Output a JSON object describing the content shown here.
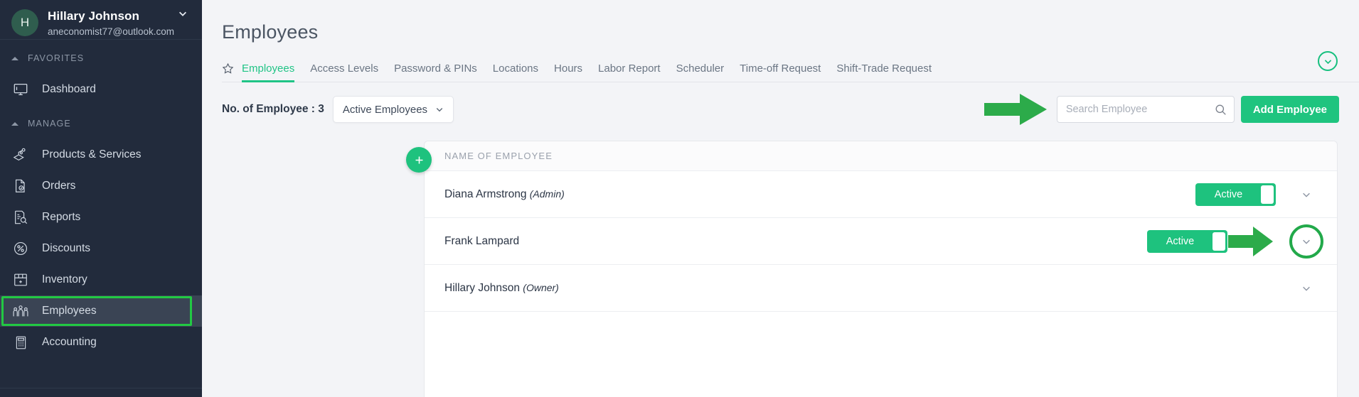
{
  "sidebar": {
    "user": {
      "avatar_initial": "H",
      "name": "Hillary Johnson",
      "email": "aneconomist77@outlook.com",
      "caret_icon": "chevron-down-icon"
    },
    "sections": [
      {
        "label": "FAVORITES",
        "items": [
          {
            "label": "Dashboard",
            "icon": "monitor-icon",
            "active": false
          }
        ]
      },
      {
        "label": "MANAGE",
        "items": [
          {
            "label": "Products & Services",
            "icon": "products-icon",
            "active": false
          },
          {
            "label": "Orders",
            "icon": "document-check-icon",
            "active": false
          },
          {
            "label": "Reports",
            "icon": "report-search-icon",
            "active": false
          },
          {
            "label": "Discounts",
            "icon": "percent-badge-icon",
            "active": false
          },
          {
            "label": "Inventory",
            "icon": "store-icon",
            "active": false
          },
          {
            "label": "Employees",
            "icon": "people-group-icon",
            "active": true
          },
          {
            "label": "Accounting",
            "icon": "calculator-icon",
            "active": false
          }
        ]
      }
    ]
  },
  "main": {
    "page_title": "Employees",
    "favorite_star_icon": "star-outline-icon",
    "tabs": [
      {
        "label": "Employees",
        "selected": true
      },
      {
        "label": "Access Levels",
        "selected": false
      },
      {
        "label": "Password & PINs",
        "selected": false
      },
      {
        "label": "Locations",
        "selected": false
      },
      {
        "label": "Hours",
        "selected": false
      },
      {
        "label": "Labor Report",
        "selected": false
      },
      {
        "label": "Scheduler",
        "selected": false
      },
      {
        "label": "Time-off Request",
        "selected": false
      },
      {
        "label": "Shift-Trade Request",
        "selected": false
      }
    ],
    "tab_expand_icon": "chevron-down-circle-icon",
    "toolbar": {
      "employee_count_label": "No. of Employee : 3",
      "filter_selected": "Active Employees",
      "filter_chevron_icon": "chevron-down-icon",
      "search_placeholder": "Search Employee",
      "search_value": "",
      "search_icon": "search-icon",
      "add_button_label": "Add Employee"
    },
    "table": {
      "add_row_icon": "plus-icon",
      "column_header": "NAME OF EMPLOYEE",
      "rows": [
        {
          "name": "Diana Armstrong",
          "role": "(Admin)",
          "status_label": "Active",
          "has_status": true,
          "expand_icon": "chevron-down-icon",
          "highlighted": false
        },
        {
          "name": "Frank Lampard",
          "role": "",
          "status_label": "Active",
          "has_status": true,
          "expand_icon": "chevron-down-icon",
          "highlighted": true
        },
        {
          "name": "Hillary Johnson",
          "role": "(Owner)",
          "status_label": "",
          "has_status": false,
          "expand_icon": "chevron-down-icon",
          "highlighted": false
        }
      ]
    }
  },
  "annotations": {
    "search_arrow_icon": "green-arrow-right-icon",
    "row_arrow_icon": "green-arrow-right-icon",
    "sidebar_highlight_color": "#22c943",
    "accent_color": "#1ec27e",
    "sidebar_color": "#222b3c"
  }
}
